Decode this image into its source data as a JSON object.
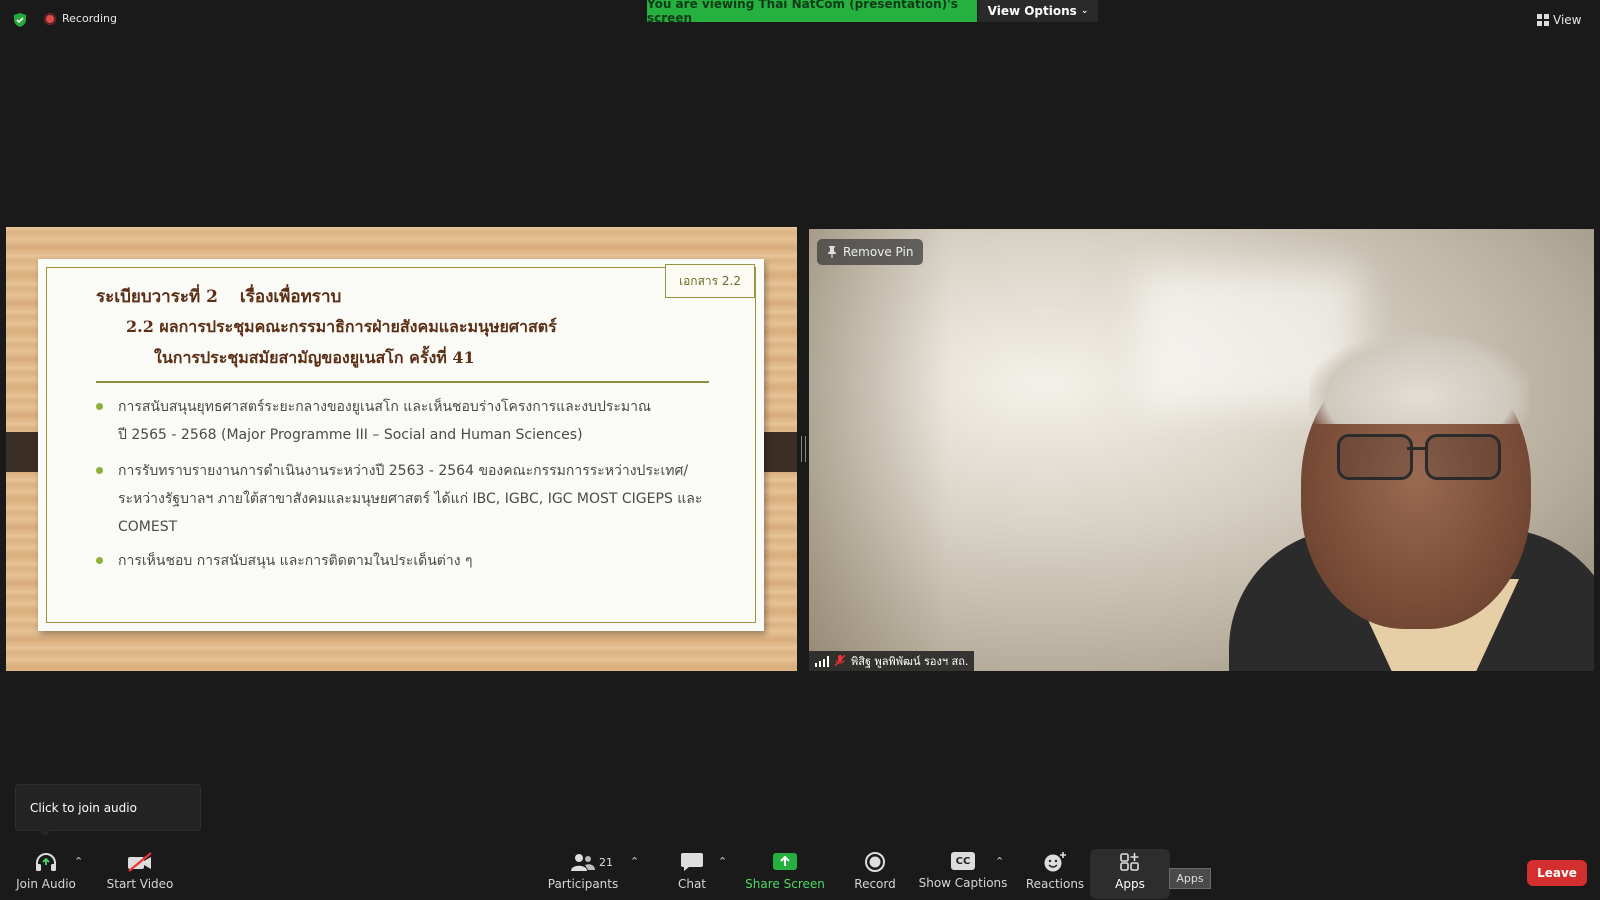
{
  "topbar": {
    "recording_label": "Recording",
    "banner_text": "You are viewing Thai NatCom (presentation)'s screen",
    "view_options_label": "View Options",
    "view_label": "View"
  },
  "slide": {
    "doc_tag": "เอกสาร 2.2",
    "agenda": "ระเบียบวาระที่ 2",
    "agenda_topic": "เรื่องเพื่อทราบ",
    "subtitle_1": "2.2 ผลการประชุมคณะกรรมาธิการฝ่ายสังคมและมนุษยศาสตร์",
    "subtitle_2": "ในการประชุมสมัยสามัญของยูเนสโก ครั้งที่ 41",
    "bullets": [
      {
        "line1": "การสนับสนุนยุทธศาสตร์ระยะกลางของยูเนสโก และเห็นชอบร่างโครงการและงบประมาณ",
        "line2": "ปี 2565 - 2568 (Major Programme III – Social and Human Sciences)",
        "line3": ""
      },
      {
        "line1": "การรับทราบรายงานการดำเนินงานระหว่างปี 2563 - 2564 ของคณะกรรมการระหว่างประเทศ/",
        "line2": "ระหว่างรัฐบาลฯ ภายใต้สาขาสังคมและมนุษยศาสตร์ ได้แก่ IBC, IGBC, IGC MOST CIGEPS และ",
        "line3": "COMEST"
      },
      {
        "line1": "การเห็นชอบ การสนับสนุน และการติดตามในประเด็นต่าง ๆ",
        "line2": "",
        "line3": ""
      }
    ]
  },
  "video": {
    "remove_pin_label": "Remove Pin",
    "participant_name": "พิสิฐ พูลพิพัฒน์ รองฯ สถ."
  },
  "tooltip": {
    "text": "Click to join audio"
  },
  "toolbar": {
    "join_audio": "Join Audio",
    "start_video": "Start Video",
    "participants": "Participants",
    "participants_count": "21",
    "chat": "Chat",
    "share_screen": "Share Screen",
    "record": "Record",
    "show_captions": "Show Captions",
    "captions_icon_text": "CC",
    "reactions": "Reactions",
    "apps": "Apps",
    "apps_tooltip": "Apps",
    "leave": "Leave"
  },
  "colors": {
    "banner_green": "#25b040",
    "share_green": "#4cd964",
    "leave_red": "#d32f2f",
    "recording_red": "#e24a4a",
    "slide_title_brown": "#5b2f16"
  }
}
